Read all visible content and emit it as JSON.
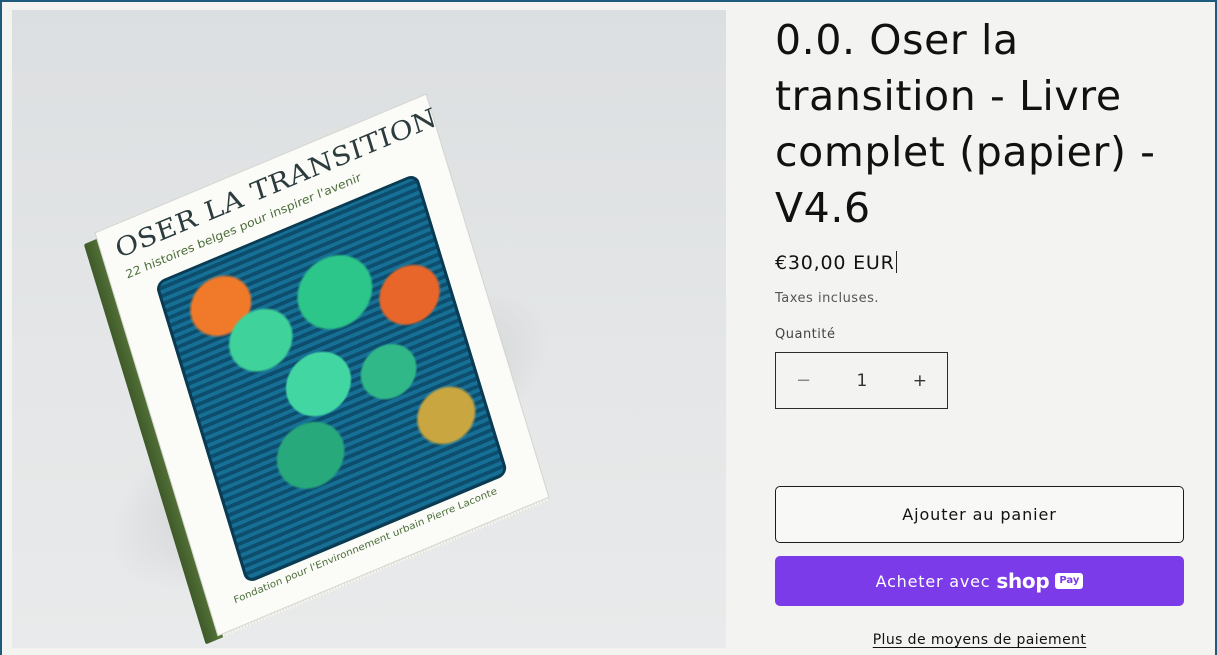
{
  "product": {
    "title": "0.0. Oser la transition - Livre complet (papier) - V4.6",
    "price": "€30,00 EUR",
    "tax_note": "Taxes incluses.",
    "quantity_label": "Quantité",
    "quantity_value": "1",
    "decrement_symbol": "−",
    "increment_symbol": "+"
  },
  "book_cover": {
    "title": "OSER LA TRANSITION",
    "subtitle": "22 histoires belges pour inspirer l'avenir",
    "publisher": "Fondation pour l'Environnement urbain Pierre Laconte"
  },
  "actions": {
    "add_to_cart": "Ajouter au panier",
    "shop_pay_prefix": "Acheter avec",
    "shop_pay_brand": "shop",
    "shop_pay_badge": "Pay",
    "more_payment": "Plus de moyens de paiement"
  },
  "colors": {
    "accent_shop_pay": "#7b3be8",
    "page_background": "#f3f3f1",
    "text_primary": "#121212"
  }
}
